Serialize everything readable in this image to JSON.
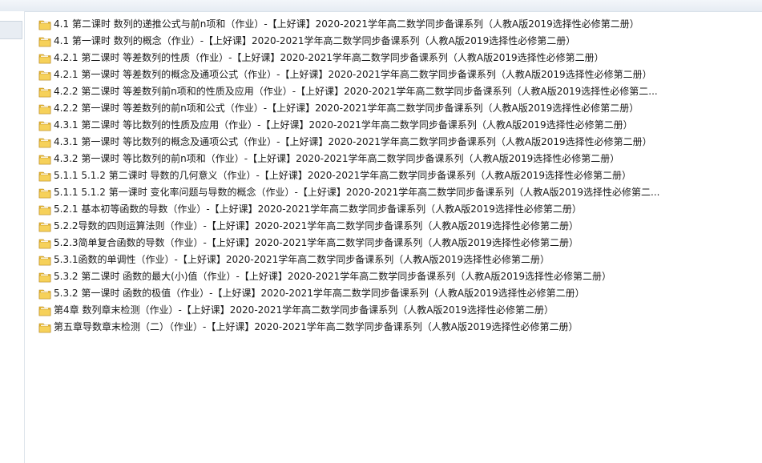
{
  "files": [
    {
      "name": "4.1  第二课时   数列的递推公式与前n项和（作业）-【上好课】2020-2021学年高二数学同步备课系列（人教A版2019选择性必修第二册）"
    },
    {
      "name": "4.1  第一课时   数列的概念（作业）-【上好课】2020-2021学年高二数学同步备课系列（人教A版2019选择性必修第二册）"
    },
    {
      "name": "4.2.1   第二课时   等差数列的性质（作业）-【上好课】2020-2021学年高二数学同步备课系列（人教A版2019选择性必修第二册）"
    },
    {
      "name": "4.2.1   第一课时   等差数列的概念及通项公式（作业）-【上好课】2020-2021学年高二数学同步备课系列（人教A版2019选择性必修第二册）"
    },
    {
      "name": "4.2.2   第二课时   等差数列前n项和的性质及应用（作业）-【上好课】2020-2021学年高二数学同步备课系列（人教A版2019选择性必修第二..."
    },
    {
      "name": "4.2.2   第一课时   等差数列的前n项和公式（作业）-【上好课】2020-2021学年高二数学同步备课系列（人教A版2019选择性必修第二册）"
    },
    {
      "name": "4.3.1   第二课时   等比数列的性质及应用（作业）-【上好课】2020-2021学年高二数学同步备课系列（人教A版2019选择性必修第二册）"
    },
    {
      "name": "4.3.1   第一课时   等比数列的概念及通项公式（作业）-【上好课】2020-2021学年高二数学同步备课系列（人教A版2019选择性必修第二册）"
    },
    {
      "name": "4.3.2   第一课时   等比数列的前n项和（作业）-【上好课】2020-2021学年高二数学同步备课系列（人教A版2019选择性必修第二册）"
    },
    {
      "name": "5.1.1   5.1.2   第二课时   导数的几何意义（作业）-【上好课】2020-2021学年高二数学同步备课系列（人教A版2019选择性必修第二册）"
    },
    {
      "name": "5.1.1   5.1.2   第一课时   变化率问题与导数的概念（作业）-【上好课】2020-2021学年高二数学同步备课系列（人教A版2019选择性必修第二..."
    },
    {
      "name": "5.2.1 基本初等函数的导数（作业）-【上好课】2020-2021学年高二数学同步备课系列（人教A版2019选择性必修第二册）"
    },
    {
      "name": "5.2.2导数的四则运算法则（作业）-【上好课】2020-2021学年高二数学同步备课系列（人教A版2019选择性必修第二册）"
    },
    {
      "name": "5.2.3简单复合函数的导数（作业）-【上好课】2020-2021学年高二数学同步备课系列（人教A版2019选择性必修第二册）"
    },
    {
      "name": "5.3.1函数的单调性（作业）-【上好课】2020-2021学年高二数学同步备课系列（人教A版2019选择性必修第二册）"
    },
    {
      "name": "5.3.2   第二课时   函数的最大(小)值（作业）-【上好课】2020-2021学年高二数学同步备课系列（人教A版2019选择性必修第二册）"
    },
    {
      "name": "5.3.2   第一课时   函数的极值（作业）-【上好课】2020-2021学年高二数学同步备课系列（人教A版2019选择性必修第二册）"
    },
    {
      "name": "第4章 数列章末检测（作业）-【上好课】2020-2021学年高二数学同步备课系列（人教A版2019选择性必修第二册）"
    },
    {
      "name": "第五章导数章末检测（二）（作业）-【上好课】2020-2021学年高二数学同步备课系列（人教A版2019选择性必修第二册）"
    }
  ],
  "icon": "folder-icon",
  "colors": {
    "folder_body": "#e8b930",
    "folder_front": "#f6d15a",
    "folder_edge": "#b7861a",
    "text": "#1a1a1a"
  }
}
